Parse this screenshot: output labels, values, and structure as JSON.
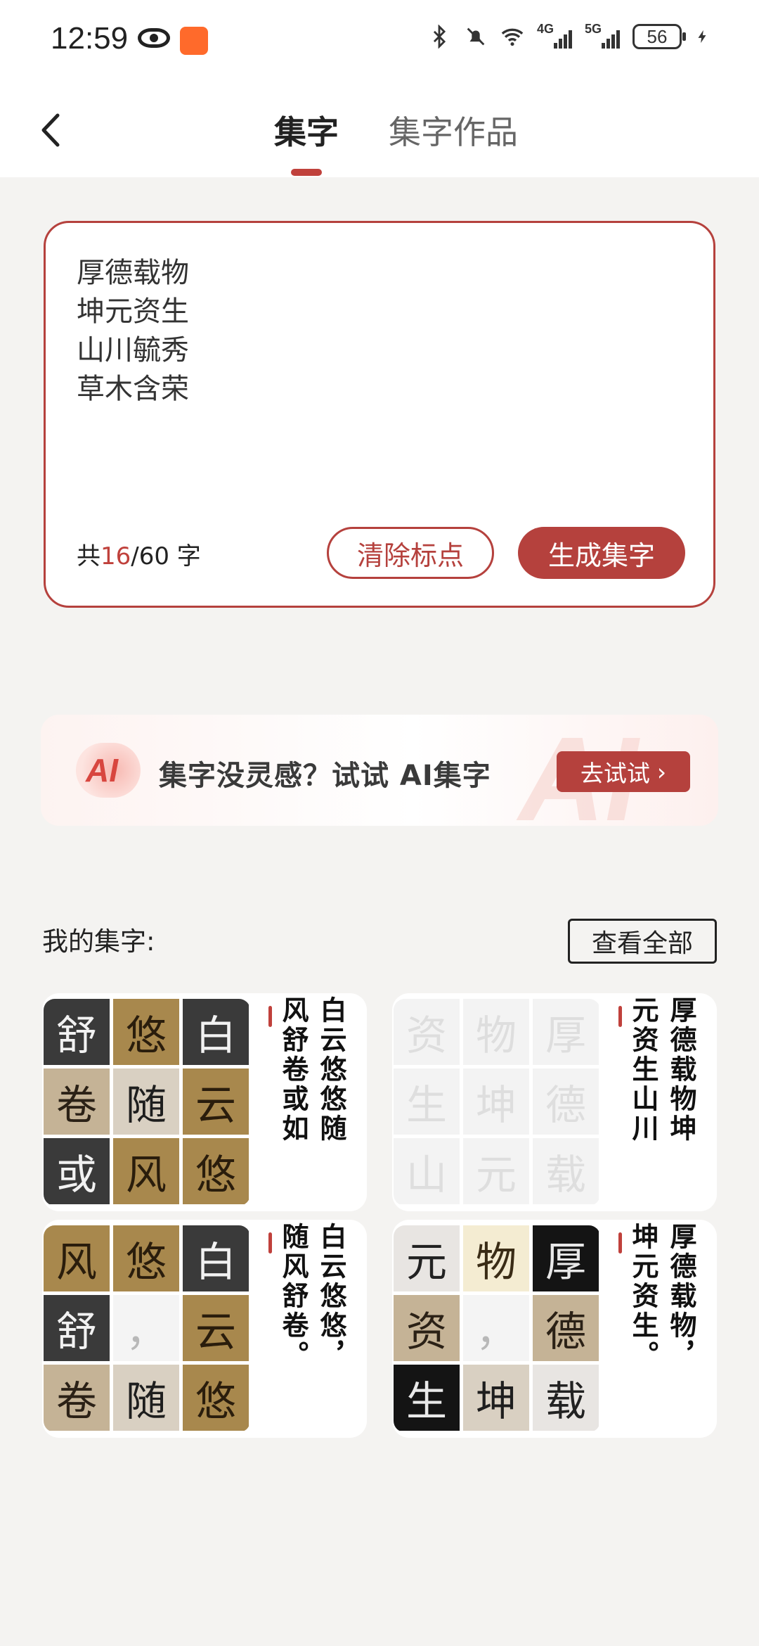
{
  "status_bar": {
    "time": "12:59",
    "net1": "4G",
    "net2": "5G",
    "battery": "56"
  },
  "header": {
    "tab_active": "集字",
    "tab_inactive": "集字作品"
  },
  "input": {
    "text": "厚德载物\n坤元资生\n山川毓秀\n草木含荣",
    "counter_prefix": "共",
    "counter_current": "16",
    "counter_suffix": "/60 字",
    "clear_label": "清除标点",
    "generate_label": "生成集字"
  },
  "ai_banner": {
    "badge": "AI",
    "watermark": "AI",
    "text": "集字没灵感？试试 AI集字",
    "button": "去试试",
    "button_arrow": "›"
  },
  "collections": {
    "title": "我的集字:",
    "view_all": "查看全部",
    "cards": [
      {
        "tiles": [
          {
            "ch": "舒",
            "style": "t-dark"
          },
          {
            "ch": "悠",
            "style": "t-gold"
          },
          {
            "ch": "白",
            "style": "t-dark"
          },
          {
            "ch": "卷",
            "style": "t-tan"
          },
          {
            "ch": "随",
            "style": "t-light"
          },
          {
            "ch": "云",
            "style": "t-gold"
          },
          {
            "ch": "或",
            "style": "t-dark"
          },
          {
            "ch": "风",
            "style": "t-gold"
          },
          {
            "ch": "悠",
            "style": "t-gold"
          }
        ],
        "col1": "白云悠悠随",
        "col2": "风舒卷或如"
      },
      {
        "tiles": [
          {
            "ch": "资",
            "style": "t-ghost"
          },
          {
            "ch": "物",
            "style": "t-ghost"
          },
          {
            "ch": "厚",
            "style": "t-ghost"
          },
          {
            "ch": "生",
            "style": "t-ghost"
          },
          {
            "ch": "坤",
            "style": "t-ghost"
          },
          {
            "ch": "德",
            "style": "t-ghost"
          },
          {
            "ch": "山",
            "style": "t-ghost"
          },
          {
            "ch": "元",
            "style": "t-ghost"
          },
          {
            "ch": "载",
            "style": "t-ghost"
          }
        ],
        "col1": "厚德载物坤",
        "col2": "元资生山川"
      },
      {
        "tiles": [
          {
            "ch": "风",
            "style": "t-gold"
          },
          {
            "ch": "悠",
            "style": "t-gold"
          },
          {
            "ch": "白",
            "style": "t-dark"
          },
          {
            "ch": "舒",
            "style": "t-dark"
          },
          {
            "ch": "，",
            "style": "t-empty"
          },
          {
            "ch": "云",
            "style": "t-gold"
          },
          {
            "ch": "卷",
            "style": "t-tan"
          },
          {
            "ch": "随",
            "style": "t-light"
          },
          {
            "ch": "悠",
            "style": "t-gold"
          }
        ],
        "col1": "白云悠悠，",
        "col2": "随风舒卷。"
      },
      {
        "tiles": [
          {
            "ch": "元",
            "style": "t-pale"
          },
          {
            "ch": "物",
            "style": "t-cream"
          },
          {
            "ch": "厚",
            "style": "t-black"
          },
          {
            "ch": "资",
            "style": "t-tan"
          },
          {
            "ch": "，",
            "style": "t-empty"
          },
          {
            "ch": "德",
            "style": "t-tan"
          },
          {
            "ch": "生",
            "style": "t-black"
          },
          {
            "ch": "坤",
            "style": "t-light"
          },
          {
            "ch": "载",
            "style": "t-pale"
          }
        ],
        "col1": "厚德载物，",
        "col2": "坤元资生。"
      }
    ]
  },
  "colors": {
    "accent": "#b5413d",
    "background": "#f4f3f1"
  }
}
